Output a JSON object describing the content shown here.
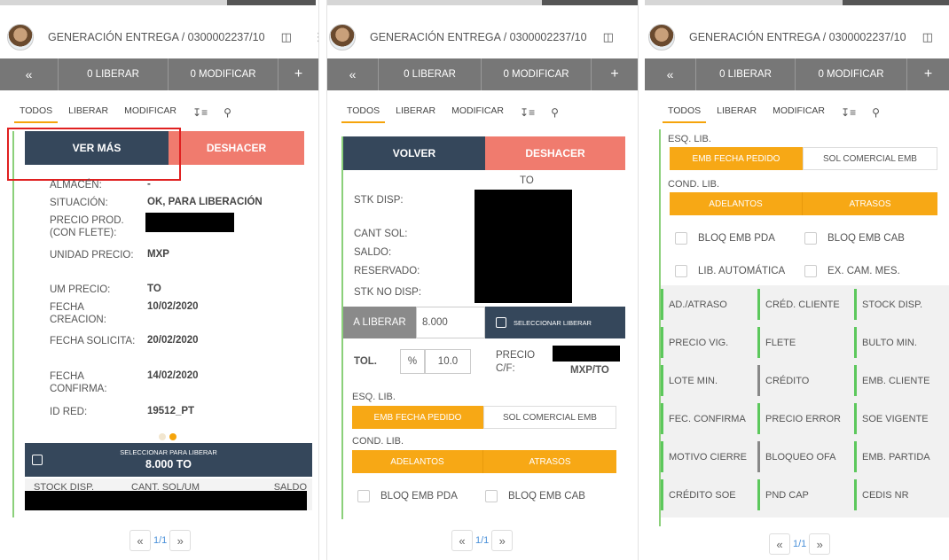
{
  "header": {
    "title": "GENERACIÓN ENTREGA / 0300002237/10"
  },
  "actions": {
    "back": "«",
    "liberar": "0 LIBERAR",
    "modificar": "0 MODIFICAR",
    "plus": "+"
  },
  "tabs": [
    "TODOS",
    "LIBERAR",
    "MODIFICAR"
  ],
  "panel1": {
    "ver_mas": "VER MÁS",
    "deshacer": "DESHACER",
    "fields": [
      {
        "key": "ALMACÉN:",
        "value": "-"
      },
      {
        "key": "SITUACIÓN:",
        "value": "OK, PARA LIBERACIÓN"
      },
      {
        "key": "PRECIO PROD. (CON FLETE):",
        "value": ""
      },
      {
        "key": "UNIDAD PRECIO:",
        "value": "MXP"
      },
      {
        "key": "UM PRECIO:",
        "value": "TO"
      },
      {
        "key": "FECHA CREACION:",
        "value": "10/02/2020"
      },
      {
        "key": "FECHA SOLICITA:",
        "value": "20/02/2020"
      },
      {
        "key": "FECHA CONFIRMA:",
        "value": "14/02/2020"
      },
      {
        "key": "ID RED:",
        "value": "19512_PT"
      }
    ],
    "select_label": "SELECCIONAR PARA LIBERAR",
    "select_amount": "8.000 TO",
    "table_headers": [
      "STOCK DISP.",
      "CANT. SOL/UM",
      "SALDO"
    ],
    "pager": "1/1"
  },
  "panel2": {
    "volver": "VOLVER",
    "deshacer": "DESHACER",
    "to": "TO",
    "stock_labels": [
      "STK DISP:",
      "CANT SOL:",
      "SALDO:",
      "RESERVADO:",
      "STK NO DISP:"
    ],
    "a_liberar": "A LIBERAR",
    "a_liberar_value": "8.000",
    "seleccionar_liberar": "SELECCIONAR LIBERAR",
    "tol": "TOL.",
    "percent": "%",
    "tol_value": "10.0",
    "precio_cf": "PRECIO C/F:",
    "precio_unit": "MXP/TO",
    "esq_lib": "ESQ. LIB.",
    "esq_options": [
      "EMB FECHA PEDIDO",
      "SOL COMERCIAL EMB"
    ],
    "cond_lib": "COND. LIB.",
    "cond_options": [
      "ADELANTOS",
      "ATRASOS"
    ],
    "checks": [
      "BLOQ EMB PDA",
      "BLOQ EMB CAB"
    ],
    "pager": "1/1"
  },
  "panel3": {
    "esq_lib": "ESQ. LIB.",
    "esq_options": [
      "EMB FECHA PEDIDO",
      "SOL COMERCIAL EMB"
    ],
    "cond_lib": "COND. LIB.",
    "cond_options": [
      "ADELANTOS",
      "ATRASOS"
    ],
    "checks": [
      "BLOQ EMB PDA",
      "BLOQ EMB CAB",
      "LIB. AUTOMÁTICA",
      "EX. CAM. MES."
    ],
    "grid": [
      "AD./ATRASO",
      "CRÉD. CLIENTE",
      "STOCK DISP.",
      "PRECIO VIG.",
      "FLETE",
      "BULTO MIN.",
      "LOTE MIN.",
      "CRÉDITO",
      "EMB. CLIENTE",
      "FEC. CONFIRMA",
      "PRECIO ERROR",
      "SOE VIGENTE",
      "MOTIVO CIERRE",
      "BLOQUEO OFA",
      "EMB. PARTIDA",
      "CRÉDITO SOE",
      "PND CAP",
      "CEDIS NR"
    ],
    "pager": "1/1"
  },
  "colors": {
    "accent": "#f7a815",
    "dark": "#35475b",
    "salmon": "#f07b6e",
    "green": "#5cc85c",
    "actionbar": "#777777"
  }
}
